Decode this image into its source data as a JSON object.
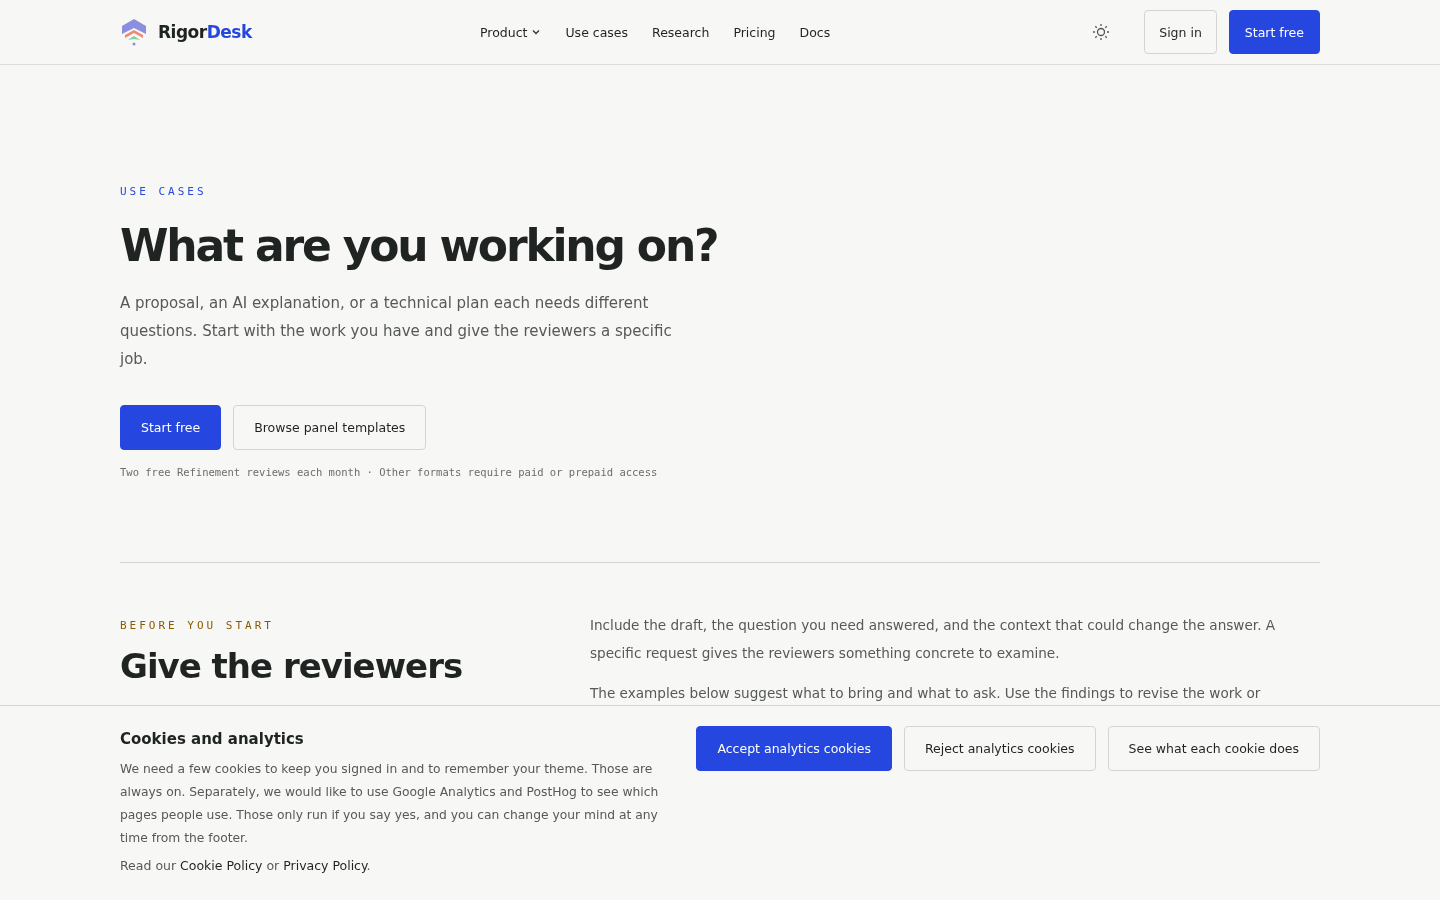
{
  "header": {
    "brand": {
      "first": "Rigor",
      "second": "Desk"
    },
    "nav": [
      {
        "label": "Product",
        "dropdown": true
      },
      {
        "label": "Use cases",
        "dropdown": false
      },
      {
        "label": "Research",
        "dropdown": false
      },
      {
        "label": "Pricing",
        "dropdown": false
      },
      {
        "label": "Docs",
        "dropdown": false
      }
    ],
    "sign_in": "Sign in",
    "start": "Start free"
  },
  "hero": {
    "eyebrow": "USE CASES",
    "title": "What are you working on?",
    "lead": "A proposal, an AI explanation, or a technical plan each needs different questions. Start with the work you have and give the reviewers a specific job.",
    "primary": "Start free",
    "secondary": "Browse panel templates",
    "note": "Two free Refinement reviews each month · Other formats require paid or prepaid access"
  },
  "section": {
    "eyebrow": "BEFORE YOU START",
    "title": "Give the reviewers",
    "paragraphs": [
      "Include the draft, the question you need answered, and the context that could change the answer. A specific request gives the reviewers something concrete to examine.",
      "The examples below suggest what to bring and what to ask. Use the findings to revise the work or"
    ]
  },
  "cookie_banner": {
    "title": "Cookies and analytics",
    "body": "We need a few cookies to keep you signed in and to remember your theme. Those are always on. Separately, we would like to use Google Analytics and PostHog to see which pages people use. Those only run if you say yes, and you can change your mind at any time from the footer.",
    "read_prefix": "Read our",
    "links": [
      "Cookie Policy",
      "Privacy Policy"
    ],
    "read_or": "or",
    "read_suffix": ".",
    "buttons": [
      {
        "label": "Accept analytics cookies",
        "kind": "primary"
      },
      {
        "label": "Reject analytics cookies",
        "kind": "secondary"
      },
      {
        "label": "See what each cookie does",
        "kind": "secondary"
      }
    ]
  }
}
